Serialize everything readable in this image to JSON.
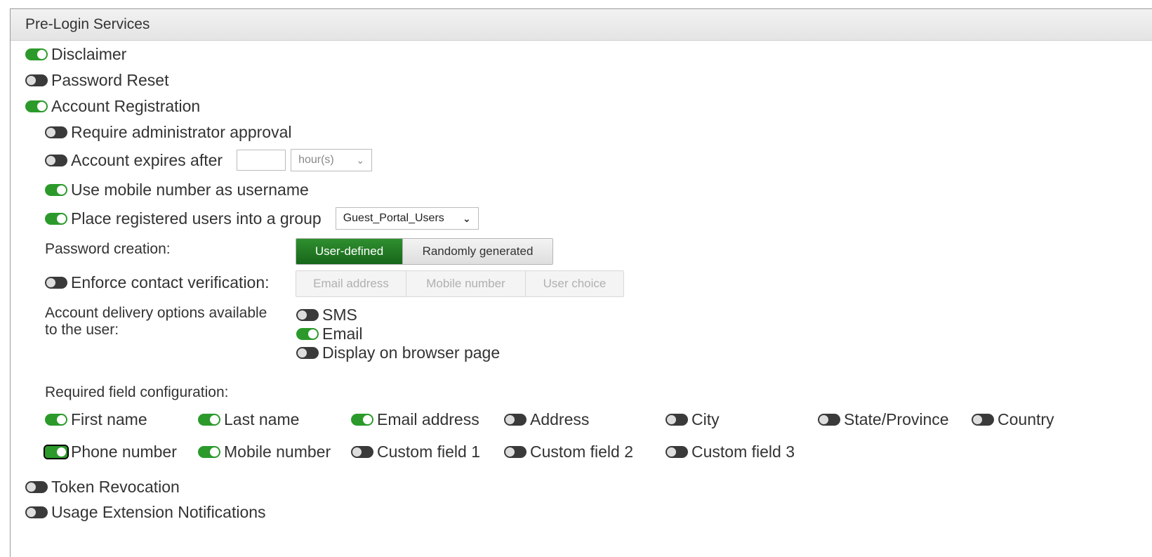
{
  "header": {
    "title": "Pre-Login Services"
  },
  "services": {
    "disclaimer": {
      "label": "Disclaimer",
      "on": true
    },
    "password_reset": {
      "label": "Password Reset",
      "on": false
    },
    "account_registration": {
      "label": "Account Registration",
      "on": true
    },
    "token_revocation": {
      "label": "Token Revocation",
      "on": false
    },
    "usage_extension": {
      "label": "Usage Extension Notifications",
      "on": false
    }
  },
  "registration": {
    "admin_approval": {
      "label": "Require administrator approval",
      "on": false
    },
    "expires": {
      "label": "Account expires after",
      "on": false,
      "value": "",
      "unit": "hour(s)"
    },
    "mobile_username": {
      "label": "Use mobile number as username",
      "on": true
    },
    "place_group": {
      "label": "Place registered users into a group",
      "on": true,
      "group": "Guest_Portal_Users"
    },
    "password_creation": {
      "label": "Password creation:",
      "options": [
        "User-defined",
        "Randomly generated"
      ],
      "selected": "User-defined"
    },
    "contact_verification": {
      "label": "Enforce contact verification:",
      "on": false,
      "options": [
        "Email address",
        "Mobile number",
        "User choice"
      ]
    },
    "delivery": {
      "label_line1": "Account delivery options available",
      "label_line2": "to the user:",
      "sms": {
        "label": "SMS",
        "on": false
      },
      "email": {
        "label": "Email",
        "on": true
      },
      "browser": {
        "label": "Display on browser page",
        "on": false
      }
    },
    "required_fields": {
      "label": "Required field configuration:",
      "first_name": {
        "label": "First name",
        "on": true
      },
      "last_name": {
        "label": "Last name",
        "on": true
      },
      "email_address": {
        "label": "Email address",
        "on": true
      },
      "address": {
        "label": "Address",
        "on": false
      },
      "city": {
        "label": "City",
        "on": false
      },
      "state": {
        "label": "State/Province",
        "on": false
      },
      "country": {
        "label": "Country",
        "on": false
      },
      "phone": {
        "label": "Phone number",
        "on": true
      },
      "mobile": {
        "label": "Mobile number",
        "on": true
      },
      "custom1": {
        "label": "Custom field 1",
        "on": false
      },
      "custom2": {
        "label": "Custom field 2",
        "on": false
      },
      "custom3": {
        "label": "Custom field 3",
        "on": false
      }
    }
  },
  "colors": {
    "toggle_on": "#2b9a2b",
    "toggle_off": "#3a3a3a",
    "segment_active": "#1f7a22"
  }
}
